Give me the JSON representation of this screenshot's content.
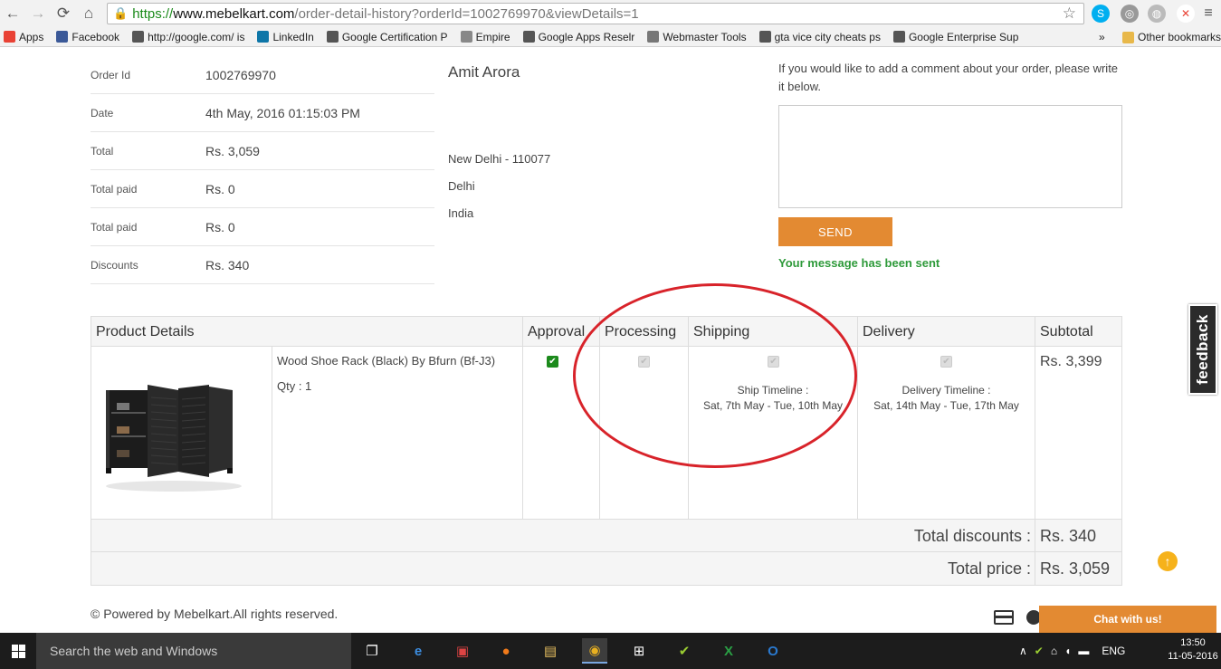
{
  "browser": {
    "url_scheme": "https://",
    "url_host": "www.mebelkart.com",
    "url_path": "/order-detail-history?orderId=1002769970&viewDetails=1"
  },
  "bookmarks": [
    {
      "label": "Apps",
      "icon": "apps-grid-icon",
      "color": "#e94235"
    },
    {
      "label": "Facebook",
      "icon": "facebook-icon",
      "color": "#3b5998"
    },
    {
      "label": "http://google.com/ is",
      "icon": "google-icon",
      "color": "#555555"
    },
    {
      "label": "LinkedIn",
      "icon": "linkedin-icon",
      "color": "#0e76a8"
    },
    {
      "label": "Google Certification P",
      "icon": "google-icon",
      "color": "#555555"
    },
    {
      "label": "Empire",
      "icon": "page-icon",
      "color": "#888888"
    },
    {
      "label": "Google Apps Reselr",
      "icon": "google-icon",
      "color": "#555555"
    },
    {
      "label": "Webmaster Tools",
      "icon": "webmaster-icon",
      "color": "#777777"
    },
    {
      "label": "gta vice city cheats ps",
      "icon": "google-icon",
      "color": "#555555"
    },
    {
      "label": "Google Enterprise Sup",
      "icon": "google-icon",
      "color": "#555555"
    }
  ],
  "bookmarks_more": "»",
  "other_bookmarks": "Other bookmarks",
  "order_info": [
    {
      "label": "Order Id",
      "value": "1002769970"
    },
    {
      "label": "Date",
      "value": "4th May, 2016 01:15:03 PM"
    },
    {
      "label": "Total",
      "value": "Rs. 3,059"
    },
    {
      "label": "Total paid",
      "value": "Rs. 0"
    },
    {
      "label": "Total paid",
      "value": "Rs. 0"
    },
    {
      "label": "Discounts",
      "value": "Rs. 340"
    }
  ],
  "address": {
    "name": "Amit Arora",
    "city": "New Delhi - 110077",
    "state": "Delhi",
    "country": "India"
  },
  "comment": {
    "prompt": "If you would like to add a comment about your order, please write it below.",
    "value": "",
    "send_label": "SEND",
    "sent_message": "Your message has been sent"
  },
  "table": {
    "headers": {
      "product": "Product Details",
      "approval": "Approval",
      "processing": "Processing",
      "shipping": "Shipping",
      "delivery": "Delivery",
      "subtotal": "Subtotal"
    },
    "item": {
      "name": "Wood Shoe Rack (Black) By Bfurn (Bf-J3)",
      "qty": "Qty : 1",
      "approval_checked": true,
      "processing_checked": false,
      "shipping_checked": false,
      "delivery_checked": false,
      "ship_timeline_label": "Ship Timeline :",
      "ship_timeline_value": "Sat, 7th May - Tue, 10th May",
      "delivery_timeline_label": "Delivery Timeline :",
      "delivery_timeline_value": "Sat, 14th May - Tue, 17th May",
      "subtotal": "Rs. 3,399"
    },
    "total_discounts_label": "Total discounts :",
    "total_discounts_value": "Rs. 340",
    "total_price_label": "Total price :",
    "total_price_value": "Rs. 3,059"
  },
  "footer": {
    "copyright": "© Powered by Mebelkart.All rights reserved."
  },
  "widgets": {
    "feedback": "feedback",
    "chat": "Chat with us!"
  },
  "taskbar": {
    "search_placeholder": "Search the web and Windows",
    "language": "ENG",
    "time": "13:50",
    "date": "11-05-2016"
  },
  "colors": {
    "accent_orange": "#e38a32",
    "success_green": "#2e9a3a",
    "annotation_red": "#d8232a"
  }
}
